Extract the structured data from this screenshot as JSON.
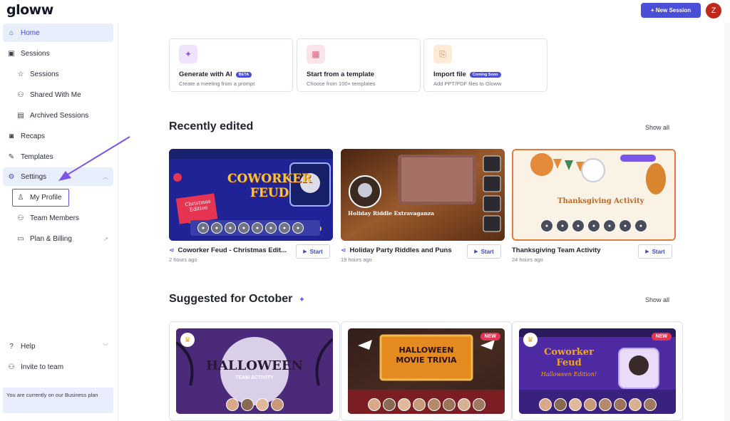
{
  "topbar": {
    "logo": "gloww",
    "new_session": "+ New Session",
    "avatar": "Z"
  },
  "sidebar": {
    "items": [
      {
        "label": "Home",
        "icon": "home-icon"
      },
      {
        "label": "Sessions",
        "icon": "calendar-icon"
      },
      {
        "label": "Sessions",
        "icon": "star-icon"
      },
      {
        "label": "Shared With Me",
        "icon": "users-icon"
      },
      {
        "label": "Archived Sessions",
        "icon": "archive-icon"
      },
      {
        "label": "Recaps",
        "icon": "recap-icon"
      },
      {
        "label": "Templates",
        "icon": "edit-icon"
      },
      {
        "label": "Settings",
        "icon": "gear-icon"
      },
      {
        "label": "My Profile",
        "icon": "user-icon"
      },
      {
        "label": "Team Members",
        "icon": "team-icon"
      },
      {
        "label": "Plan & Billing",
        "icon": "card-icon"
      },
      {
        "label": "Help",
        "icon": "help-icon"
      },
      {
        "label": "Invite to team",
        "icon": "invite-icon"
      }
    ],
    "plan_note": "You are currently on our Business plan"
  },
  "quick_actions": [
    {
      "title": "Generate with AI",
      "badge": "BETA",
      "subtitle": "Create a meeting from a prompt"
    },
    {
      "title": "Start from a template",
      "badge": "",
      "subtitle": "Choose from 100+ templates"
    },
    {
      "title": "Import file",
      "badge": "Coming Soon",
      "subtitle": "Add PPT/PDF files to Gloww"
    }
  ],
  "recently_edited": {
    "title": "Recently edited",
    "show_all": "Show all",
    "cards": [
      {
        "name": "Coworker Feud - Christmas Edit...",
        "time": "2 hours ago",
        "start": "Start",
        "thumb_title": "COWORKER FEUD",
        "thumb_badge": "Christmas Edition"
      },
      {
        "name": "Holiday Party Riddles and Puns",
        "time": "19 hours ago",
        "start": "Start",
        "thumb_title": "Holiday Riddle Extravaganza"
      },
      {
        "name": "Thanksgiving Team Activity",
        "time": "24 hours ago",
        "start": "Start",
        "thumb_title": "Thanksgiving Activity"
      }
    ]
  },
  "suggested": {
    "title": "Suggested for October",
    "show_all": "Show all",
    "cards": [
      {
        "thumb_title": "HALLOWEEN",
        "thumb_sub": "TEAM ACTIVITY",
        "badge": ""
      },
      {
        "thumb_title": "HALLOWEEN MOVIE TRIVIA",
        "badge": "NEW"
      },
      {
        "thumb_title": "Coworker Feud",
        "thumb_sub": "Halloween Edition!",
        "badge": "NEW"
      }
    ]
  },
  "colors": {
    "accent": "#4b4fd6",
    "active_bg": "#e9eefc",
    "avatar": "#c1271b",
    "new_badge": "#e53552"
  }
}
